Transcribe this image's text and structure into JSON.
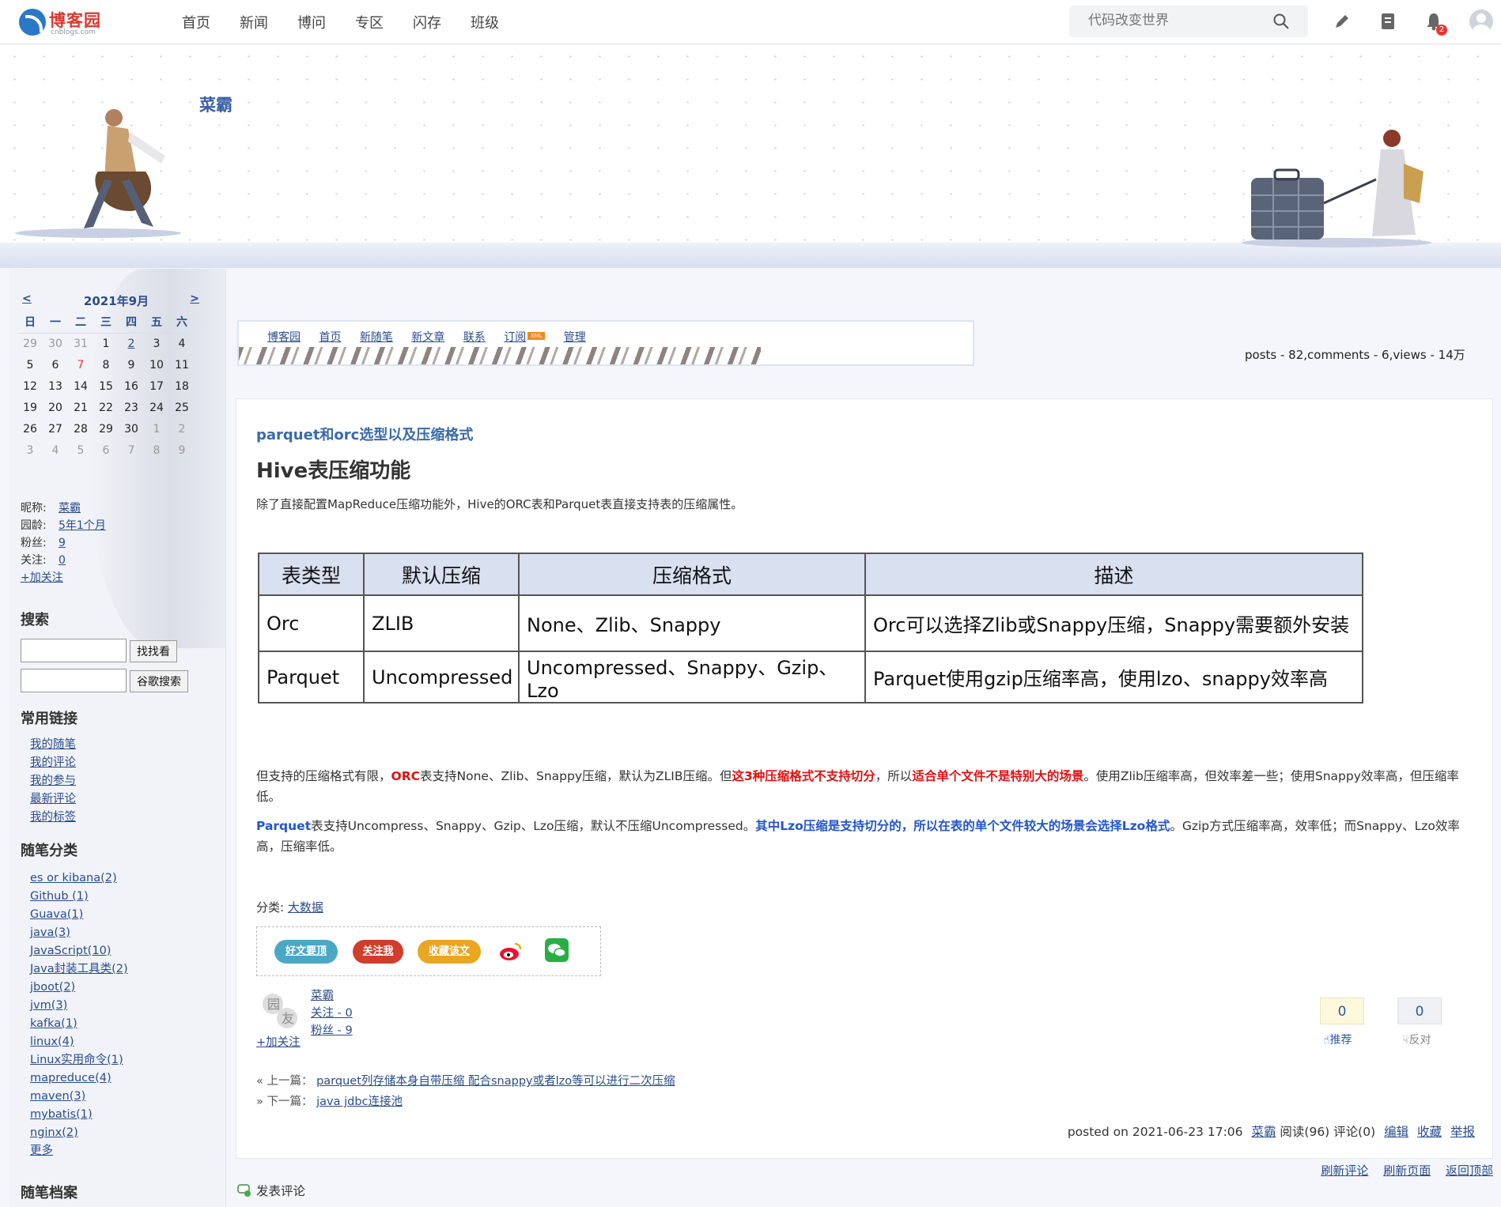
{
  "site": {
    "name": "博客园",
    "domain": "cnblogs.com"
  },
  "topnav": {
    "items": [
      "首页",
      "新闻",
      "博问",
      "专区",
      "闪存",
      "班级"
    ],
    "search_placeholder": "代码改变世界",
    "notification_count": "2"
  },
  "blog": {
    "title": "菜霸"
  },
  "calendar": {
    "prev": "<",
    "next": ">",
    "title": "2021年9月",
    "weekdays": [
      "日",
      "一",
      "二",
      "三",
      "四",
      "五",
      "六"
    ],
    "weeks": [
      [
        "29",
        "30",
        "31",
        "1",
        "2",
        "3",
        "4"
      ],
      [
        "5",
        "6",
        "7",
        "8",
        "9",
        "10",
        "11"
      ],
      [
        "12",
        "13",
        "14",
        "15",
        "16",
        "17",
        "18"
      ],
      [
        "19",
        "20",
        "21",
        "22",
        "23",
        "24",
        "25"
      ],
      [
        "26",
        "27",
        "28",
        "29",
        "30",
        "1",
        "2"
      ],
      [
        "3",
        "4",
        "5",
        "6",
        "7",
        "8",
        "9"
      ]
    ]
  },
  "profile": {
    "nickname_label": "昵称:",
    "nickname": "菜霸",
    "age_label": "园龄:",
    "age": "5年1个月",
    "fans_label": "粉丝:",
    "fans": "9",
    "follow_label": "关注:",
    "follow": "0",
    "add_follow": "+加关注"
  },
  "search_section": {
    "title": "搜索",
    "btn1": "找找看",
    "btn2": "谷歌搜索"
  },
  "links_section": {
    "title": "常用链接",
    "items": [
      "我的随笔",
      "我的评论",
      "我的参与",
      "最新评论",
      "我的标签"
    ]
  },
  "category_section": {
    "title": "随笔分类",
    "items": [
      "es or kibana(2)",
      "Github (1)",
      "Guava(1)",
      "java(3)",
      "JavaScript(10)",
      "Java封装工具类(2)",
      "jboot(2)",
      "jvm(3)",
      "kafka(1)",
      "linux(4)",
      "Linux实用命令(1)",
      "mapreduce(4)",
      "maven(3)",
      "mybatis(1)",
      "nginx(2)",
      "更多"
    ]
  },
  "archive_section": {
    "title": "随笔档案"
  },
  "blognav": {
    "items": [
      "博客园",
      "首页",
      "新随笔",
      "新文章",
      "联系",
      "订阅",
      "管理"
    ],
    "xml": "XML"
  },
  "stats": "posts - 82,comments - 6,views - 14万",
  "post": {
    "title": "parquet和orc选型以及压缩格式",
    "heading": "Hive表压缩功能",
    "intro": "除了直接配置MapReduce压缩功能外，Hive的ORC表和Parquet表直接支持表的压缩属性。",
    "table": {
      "headers": [
        "表类型",
        "默认压缩",
        "压缩格式",
        "描述"
      ],
      "rows": [
        [
          "Orc",
          "ZLIB",
          "None、Zlib、Snappy",
          "Orc可以选择Zlib或Snappy压缩，Snappy需要额外安装"
        ],
        [
          "Parquet",
          "Uncompressed",
          "Uncompressed、Snappy、Gzip、Lzo",
          "Parquet使用gzip压缩率高，使用lzo、snappy效率高"
        ]
      ]
    },
    "p1": {
      "a": "但支持的压缩格式有限，",
      "b": "ORC",
      "c": "表支持None、Zlib、Snappy压缩，默认为ZLIB压缩。但",
      "d": "这3种压缩格式不支持切分",
      "e": "，所以",
      "f": "适合单个文件不是特别大的场景",
      "g": "。使用Zlib压缩率高，但效率差一些；使用Snappy效率高，但压缩率低。"
    },
    "p2": {
      "a": "Parquet",
      "b": "表支持Uncompress、Snappy、Gzip、Lzo压缩，默认不压缩Uncompressed。",
      "c": "其中Lzo压缩是支持切分的，所以在表的单个文件较大的场景会选择Lzo格式",
      "d": "。Gzip方式压缩率高，效率低；而Snappy、Lzo效率高，压缩率低。"
    },
    "category_label": "分类: ",
    "category": "大数据",
    "share": {
      "good": "好文要顶",
      "follow": "关注我",
      "favorite": "收藏该文"
    },
    "author": {
      "name": "菜霸",
      "follow": "关注 - 0",
      "fans": "粉丝 - 9",
      "add_follow": "+加关注"
    },
    "votes": {
      "digg": "0",
      "digg_label": "推荐",
      "bury": "0",
      "bury_label": "反对"
    },
    "prev_label": "« 上一篇：",
    "prev": "parquet列存储本身自带压缩 配合snappy或者lzo等可以进行二次压缩",
    "next_label": "» 下一篇：",
    "next": "java jdbc连接池",
    "footer": {
      "posted": "posted on 2021-06-23 17:06",
      "author": "菜霸",
      "reads": "阅读(96)",
      "comments": "评论(0)",
      "edit": "编辑",
      "fav": "收藏",
      "report": "举报"
    }
  },
  "page_links": {
    "refresh_comments": "刷新评论",
    "refresh_page": "刷新页面",
    "top": "返回顶部"
  },
  "comment_head": "发表评论",
  "colors": {
    "accent": "#2a4c8c",
    "red": "#e01010",
    "blue": "#2255cc"
  }
}
